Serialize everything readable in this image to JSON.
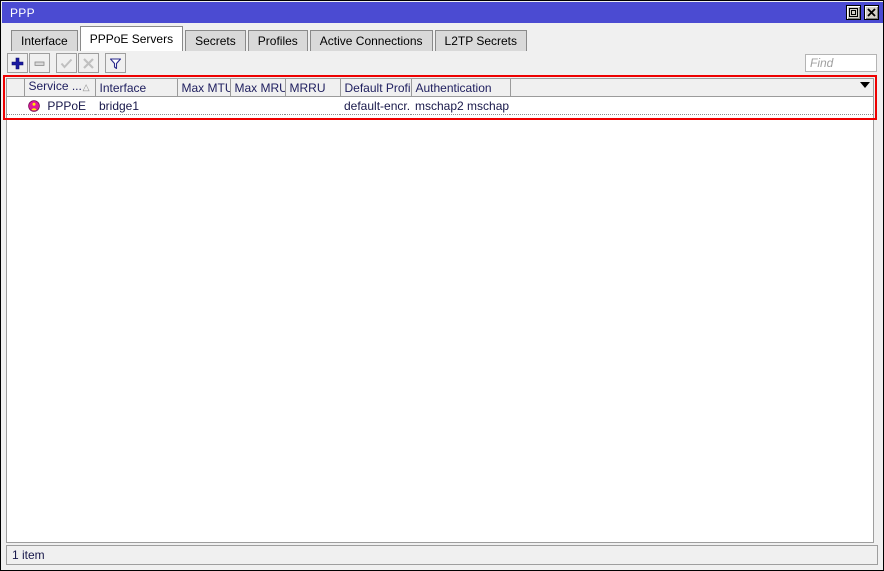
{
  "window": {
    "title": "PPP",
    "buttons": [
      {
        "name": "maximize-button",
        "icon": "maximize-icon"
      },
      {
        "name": "close-button",
        "icon": "close-icon"
      }
    ]
  },
  "tabs": [
    {
      "label": "Interface",
      "name": "tab-interface",
      "active": false
    },
    {
      "label": "PPPoE Servers",
      "name": "tab-pppoe-servers",
      "active": true
    },
    {
      "label": "Secrets",
      "name": "tab-secrets",
      "active": false
    },
    {
      "label": "Profiles",
      "name": "tab-profiles",
      "active": false
    },
    {
      "label": "Active Connections",
      "name": "tab-active-connections",
      "active": false
    },
    {
      "label": "L2TP Secrets",
      "name": "tab-l2tp-secrets",
      "active": false
    }
  ],
  "toolbar": {
    "buttons": [
      {
        "name": "add-button",
        "icon": "plus-icon",
        "enabled": true
      },
      {
        "name": "remove-button",
        "icon": "minus-icon",
        "enabled": true
      },
      {
        "name": "enable-button",
        "icon": "check-icon",
        "enabled": false
      },
      {
        "name": "disable-button",
        "icon": "cross-icon",
        "enabled": false
      },
      {
        "name": "filter-button",
        "icon": "funnel-icon",
        "enabled": true
      }
    ],
    "find": {
      "placeholder": "Find",
      "value": ""
    }
  },
  "table": {
    "columns": [
      {
        "label": "Service ...",
        "name": "column-service",
        "sorted": "ascending"
      },
      {
        "label": "Interface",
        "name": "column-interface"
      },
      {
        "label": "Max MTU",
        "name": "column-max-mtu"
      },
      {
        "label": "Max MRU",
        "name": "column-max-mru"
      },
      {
        "label": "MRRU",
        "name": "column-mrru"
      },
      {
        "label": "Default Profile",
        "name": "column-default-profile"
      },
      {
        "label": "Authentication",
        "name": "column-authentication"
      }
    ],
    "rows": [
      {
        "icon": "pppoe-service-icon",
        "service": "PPPoE",
        "interface": "bridge1",
        "max_mtu": "",
        "max_mru": "",
        "mrru": "",
        "default_profile": "default-encr...",
        "authentication": "mschap2 mschap..."
      }
    ]
  },
  "status": {
    "item_count": "1 item"
  },
  "colors": {
    "titlebar": "#4b4bd2",
    "highlight_box": "#ee0000",
    "accent_plus": "#1a1aa0",
    "row_text": "#18184a",
    "header_text": "#202060"
  }
}
